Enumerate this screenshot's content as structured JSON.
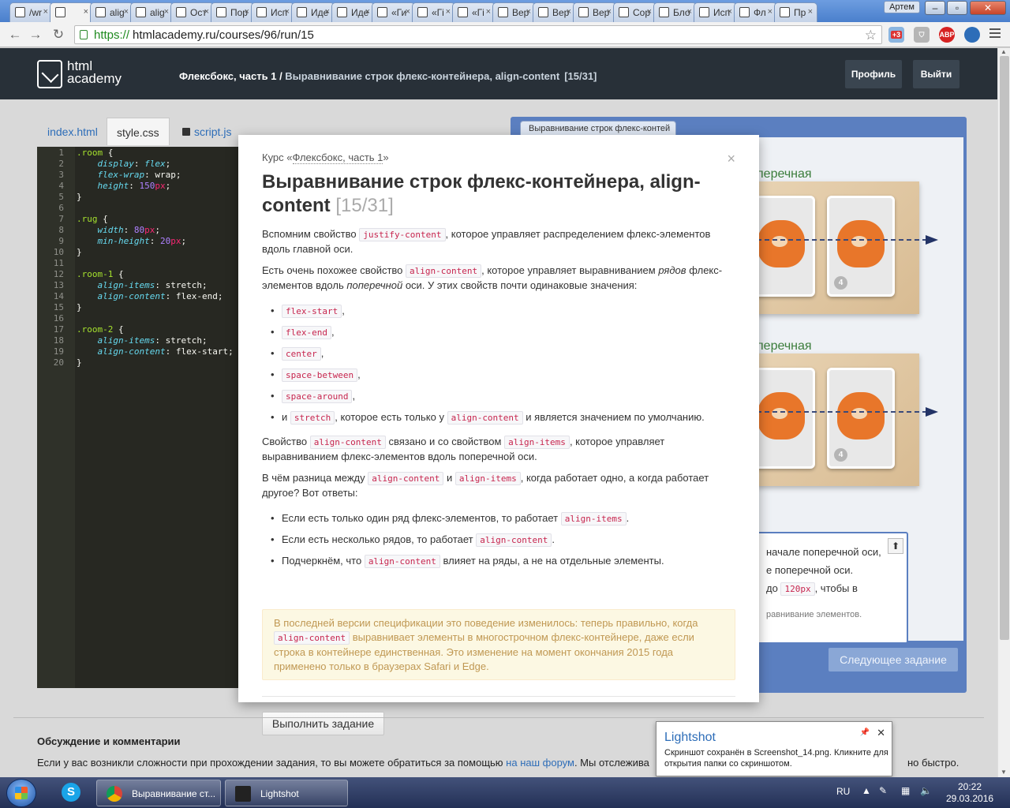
{
  "browser": {
    "tabs": [
      {
        "label": "/wr",
        "icon": "lightning-icon"
      },
      {
        "label": "",
        "icon": "htmlacademy-icon",
        "active": true
      },
      {
        "label": "alig",
        "icon": "htmlacademy-icon"
      },
      {
        "label": "alig",
        "icon": "htmlacademy-icon"
      },
      {
        "label": "Ост",
        "icon": "htmlacademy-icon"
      },
      {
        "label": "Пор",
        "icon": "htmlacademy-icon"
      },
      {
        "label": "Исп",
        "icon": "htmlacademy-icon"
      },
      {
        "label": "Иде",
        "icon": "htmlacademy-icon"
      },
      {
        "label": "Иде",
        "icon": "htmlacademy-icon"
      },
      {
        "label": "«Ги",
        "icon": "htmlacademy-icon"
      },
      {
        "label": "«Гі",
        "icon": "htmlacademy-icon"
      },
      {
        "label": "«Гі",
        "icon": "htmlacademy-icon"
      },
      {
        "label": "Вер",
        "icon": "htmlacademy-icon"
      },
      {
        "label": "Вер",
        "icon": "htmlacademy-icon"
      },
      {
        "label": "Вер",
        "icon": "htmlacademy-icon"
      },
      {
        "label": "Сор",
        "icon": "htmlacademy-icon"
      },
      {
        "label": "Бло",
        "icon": "htmlacademy-icon"
      },
      {
        "label": "Исп",
        "icon": "htmlacademy-icon"
      },
      {
        "label": "Фл",
        "icon": "htmlacademy-icon"
      },
      {
        "label": "Пр",
        "icon": "htmlacademy-icon"
      }
    ],
    "user": "Артем",
    "url_proto": "https://",
    "url_host": "htmlacademy.ru",
    "url_path": "/courses/96/run/15",
    "ext_badge": "+3",
    "abp_label": "ABP"
  },
  "header": {
    "logo_line1": "html",
    "logo_line2": "academy",
    "crumb_course": "Флексбокс, часть 1",
    "crumb_sep": " / ",
    "crumb_title": "Выравнивание строк флекс-контейнера, align-content",
    "crumb_count": "[15/31]",
    "profile_btn": "Профиль",
    "logout_btn": "Выйти"
  },
  "editor": {
    "tabs": [
      "index.html",
      "style.css",
      "script.js"
    ],
    "active_tab": "style.css",
    "line_numbers": [
      "1",
      "2",
      "3",
      "4",
      "5",
      "6",
      "7",
      "8",
      "9",
      "10",
      "11",
      "12",
      "13",
      "14",
      "15",
      "16",
      "17",
      "18",
      "19",
      "20"
    ]
  },
  "preview": {
    "tab_label": "Выравнивание строк флекс-контей",
    "room_label_1": "перечная",
    "room_label_2": "перечная",
    "card_numbers": [
      "4",
      "4"
    ],
    "hint_line1": "начале поперечной оси,",
    "hint_line2": "е поперечной оси.",
    "hint_line3_pre": "до",
    "hint_line3_code": "120px",
    "hint_line3_post": ", чтобы в",
    "hint_line4": "равнивание элементов.",
    "next_btn": "Следующее задание"
  },
  "modal": {
    "course_prefix": "Курс «",
    "course_name": "Флексбокс, часть 1",
    "course_suffix": "»",
    "title": "Выравнивание строк флекс-контейнера, align-content",
    "counter": "[15/31]",
    "p1_a": "Вспомним свойство",
    "p1_code": "justify-content",
    "p1_b": ", которое управляет распределением флекс-элементов вдоль главной оси.",
    "p2_a": "Есть очень похожее свойство",
    "p2_code": "align-content",
    "p2_b": ", которое управляет выравниванием",
    "p2_em1": "рядов",
    "p2_c": "флекс-элементов вдоль",
    "p2_em2": "поперечной",
    "p2_d": "оси. У этих свойств почти одинаковые значения:",
    "values": [
      "flex-start",
      "flex-end",
      "center",
      "space-between",
      "space-around"
    ],
    "last_item_a": "и",
    "last_item_code1": "stretch",
    "last_item_b": ", которое есть только у",
    "last_item_code2": "align-content",
    "last_item_c": "и является значением по умолчанию.",
    "p3_a": "Свойство",
    "p3_code1": "align-content",
    "p3_b": "связано и со свойством",
    "p3_code2": "align-items",
    "p3_c": ", которое управляет выравниванием флекс-элементов вдоль поперечной оси.",
    "p4_a": "В чём разница между",
    "p4_code1": "align-content",
    "p4_b": "и",
    "p4_code2": "align-items",
    "p4_c": ", когда работает одно, а когда работает другое? Вот ответы:",
    "ans1_a": "Если есть только один ряд флекс-элементов, то работает",
    "ans1_code": "align-items",
    "ans2_a": "Если есть несколько рядов, то работает",
    "ans2_code": "align-content",
    "ans3_a": "Подчеркнём, что",
    "ans3_code": "align-content",
    "ans3_b": "влияет на ряды, а не на отдельные элементы.",
    "note_a": "В последней версии спецификации это поведение изменилось: теперь правильно, когда",
    "note_code": "align-content",
    "note_b": "выравнивает элементы в многострочном флекс-контейнере, даже если строка в контейнере единственная. Это изменение на момент окончания 2015 года применено только в браузерах Safari и Edge.",
    "run_btn": "Выполнить задание"
  },
  "discussion": {
    "title": "Обсуждение и комментарии",
    "text_a": "Если у вас возникли сложности при прохождении задания, то вы можете обратиться за помощью",
    "link": "на наш форум",
    "text_b": ". Мы отслежива",
    "text_end": "но быстро."
  },
  "lightshot": {
    "title": "Lightshot",
    "text": "Скриншот сохранён в Screenshot_14.png. Кликните для открытия папки со скриншотом."
  },
  "taskbar": {
    "task1": "Выравнивание ст...",
    "task2": "Lightshot",
    "lang": "RU",
    "time": "20:22",
    "date": "29.03.2016"
  },
  "colors": {
    "header_bg": "#283038",
    "editor_bg": "#272822",
    "preview_border": "#5b7fc0",
    "code_red": "#c7254e",
    "note_bg": "#fcf8e3"
  }
}
